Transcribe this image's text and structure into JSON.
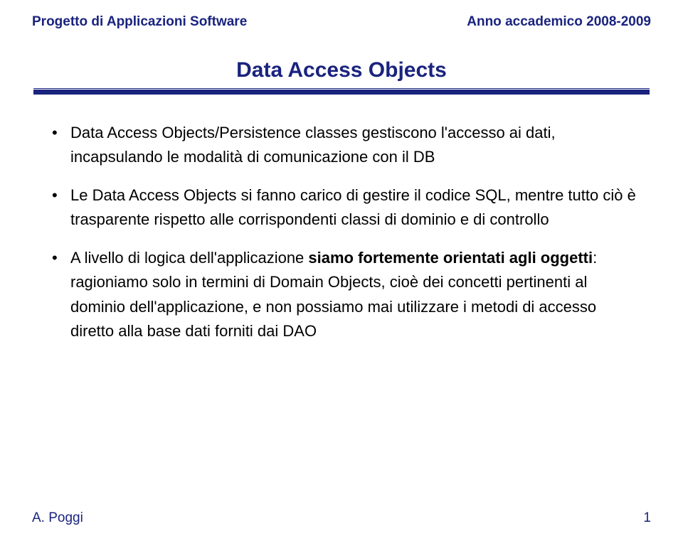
{
  "header": {
    "left": "Progetto di Applicazioni Software",
    "right": "Anno accademico 2008-2009"
  },
  "title": "Data Access Objects",
  "bullets": [
    {
      "segments": [
        {
          "text": "Data Access Objects/Persistence classes gestiscono l'accesso ai dati, incapsulando le modalità di comunicazione con il DB",
          "bold": false
        }
      ]
    },
    {
      "segments": [
        {
          "text": "Le Data Access Objects si fanno carico di gestire il codice SQL, mentre tutto ciò è trasparente rispetto alle corrispondenti classi di dominio e di controllo",
          "bold": false
        }
      ]
    },
    {
      "segments": [
        {
          "text": "A livello di logica dell'applicazione ",
          "bold": false
        },
        {
          "text": "siamo fortemente orientati agli oggetti",
          "bold": true
        },
        {
          "text": ": ragioniamo solo in termini di Domain Objects, cioè dei concetti pertinenti al dominio dell'applicazione, e non possiamo mai utilizzare i metodi di accesso diretto alla base dati forniti dai DAO",
          "bold": false
        }
      ]
    }
  ],
  "footer": {
    "left": "A. Poggi",
    "right": "1"
  }
}
